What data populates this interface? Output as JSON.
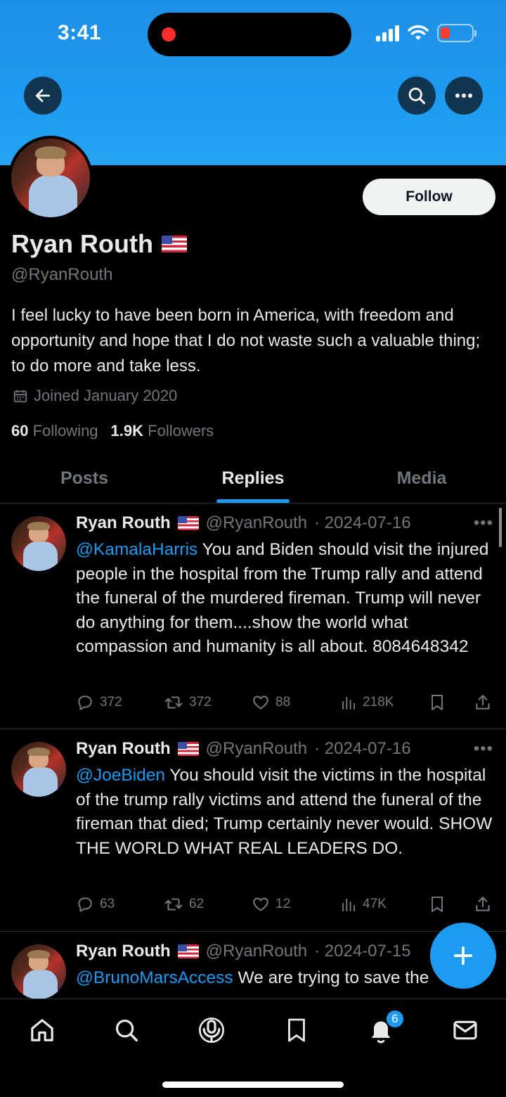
{
  "status_bar": {
    "time": "3:41"
  },
  "profile": {
    "display_name": "Ryan Routh",
    "handle": "@RyanRouth",
    "bio": "I feel lucky to have been born in America, with freedom and opportunity and hope that I do not waste such a valuable thing; to do more and take less.",
    "joined": "Joined January 2020",
    "following_count": "60",
    "following_label": "Following",
    "followers_count": "1.9K",
    "followers_label": "Followers",
    "follow_label": "Follow"
  },
  "tabs": [
    {
      "label": "Posts",
      "active": false
    },
    {
      "label": "Replies",
      "active": true
    },
    {
      "label": "Media",
      "active": false
    }
  ],
  "tweets": [
    {
      "name": "Ryan Routh",
      "handle": "@RyanRouth",
      "date": "· 2024-07-16",
      "mention": "@KamalaHarris",
      "text": " You and Biden should visit the injured people in the hospital from the Trump rally and attend the funeral of the murdered fireman. Trump will never do anything for them....show the world what compassion and humanity is all about. 8084648342",
      "replies": "372",
      "reposts": "372",
      "likes": "88",
      "views": "218K"
    },
    {
      "name": "Ryan Routh",
      "handle": "@RyanRouth",
      "date": "· 2024-07-16",
      "mention": "@JoeBiden",
      "text": " You should visit the victims in the hospital of the trump rally victims and attend the funeral of the fireman that died; Trump certainly never would. SHOW THE WORLD WHAT REAL LEADERS DO.",
      "replies": "63",
      "reposts": "62",
      "likes": "12",
      "views": "47K"
    },
    {
      "name": "Ryan Routh",
      "handle": "@RyanRouth",
      "date": "· 2024-07-15",
      "mention": "@BrunoMarsAccess",
      "text": " We are trying to save the"
    }
  ],
  "notifications_badge": "6",
  "colors": {
    "accent": "#1d9bf0",
    "banner": "#1d9bf0",
    "background": "#000000",
    "muted": "#71767b"
  },
  "battery_level": 0.15
}
